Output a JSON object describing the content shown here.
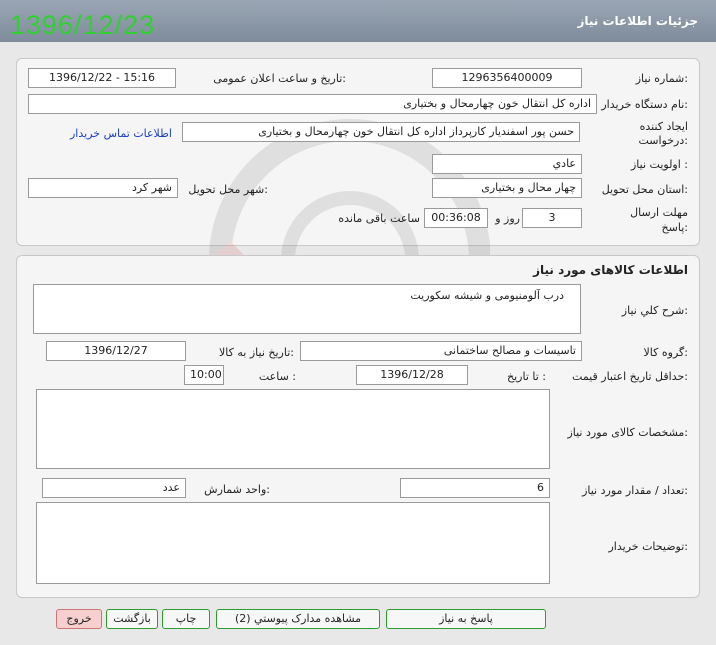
{
  "header": {
    "title": "جزئیات اطلاعات نیاز",
    "date_stamp": "1396/12/23"
  },
  "info": {
    "need_number_label": "شماره نیاز:",
    "need_number": "1296356400009",
    "announce_label": "تاریخ و ساعت اعلان عمومی:",
    "announce_value": "1396/12/22 - 15:16",
    "buyer_label": "نام دستگاه خریدار:",
    "buyer_value": "اداره کل انتقال خون چهارمحال و بختیاری",
    "creator_label_1": "ایجاد کننده",
    "creator_label_2": "درخواست:",
    "creator_value": "حسن پور اسفندیار کارپرداز اداره کل انتقال خون چهارمحال و بختیاری",
    "contact_link": "اطلاعات تماس خریدار",
    "priority_label": "اولویت نیاز :",
    "priority_value": "عادي",
    "province_label": "استان محل تحویل:",
    "province_value": "چهار محال و بختیاری",
    "city_label": "شهر محل تحویل:",
    "city_value": "شهر کرد",
    "deadline_label_1": "مهلت ارسال",
    "deadline_label_2": "پاسخ:",
    "days_value": "3",
    "days_word": "روز و",
    "time_value": "00:36:08",
    "remaining_label": "ساعت باقی مانده"
  },
  "goods": {
    "section_title": "اطلاعات کالاهای مورد نیاز",
    "summary_label": "شرح کلي نیاز:",
    "summary_value": "درب  آلومنیومی  و شیشه سکوریت",
    "group_label": "گروه کالا:",
    "group_value": "تاسیسات و مصالح ساختمانی",
    "need_date_label": "تاریخ نیاز به کالا:",
    "need_date_value": "1396/12/27",
    "validity_label": "حداقل تاریخ اعتبار قیمت:",
    "to_date_label": "تا تاریخ :",
    "to_date_value": "1396/12/28",
    "hour_label": "ساعت :",
    "hour_value": "10:00",
    "specs_label": "مشخصات کالای مورد نیاز:",
    "qty_label": "تعداد / مقدار مورد نیاز:",
    "qty_value": "6",
    "unit_label": "واحد شمارش:",
    "unit_value": "عدد",
    "buyer_notes_label": "توضیحات خریدار:"
  },
  "buttons": {
    "reply": "پاسخ به نیاز",
    "view_docs": "مشاهده مدارک پیوستي (2)",
    "print": "چاپ",
    "back": "بازگشت",
    "exit": "خروج"
  },
  "colors": {
    "link": "#1a3fc4",
    "stamp": "#2fd12f",
    "titlebar": "#8a96a5"
  }
}
